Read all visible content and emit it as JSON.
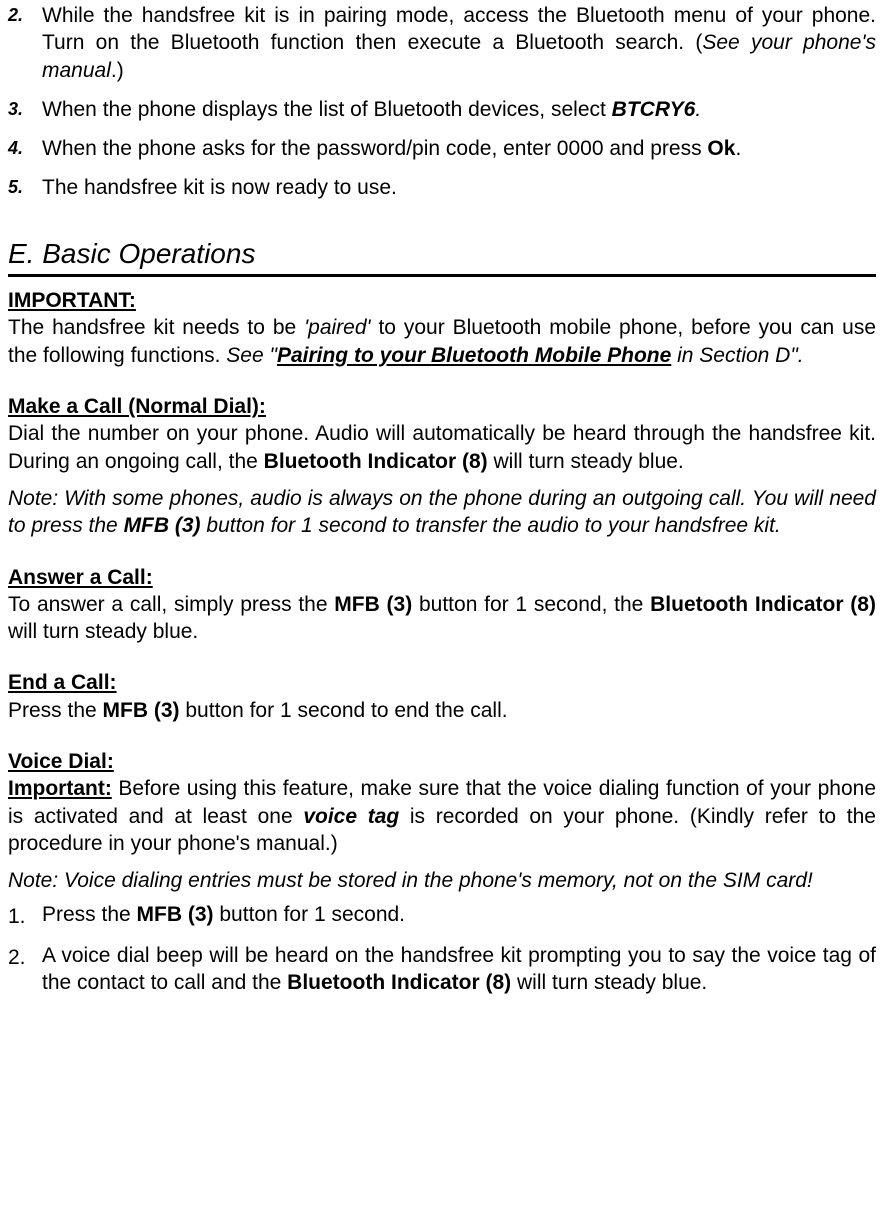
{
  "top_steps": [
    {
      "marker": "2.",
      "pre": "While the handsfree kit is in pairing mode, access the Bluetooth menu of your phone. Turn on the Bluetooth function then execute a Bluetooth search. (",
      "note": "See your phone's manual",
      "post": ".)"
    },
    {
      "marker": "3.",
      "pre": "When the phone displays the list of Bluetooth devices, select ",
      "em": "BTCRY6",
      "post": "."
    },
    {
      "marker": "4.",
      "pre": "When the phone asks for the password/pin code, enter 0000 and press ",
      "em": "Ok",
      "post": "."
    },
    {
      "marker": "5.",
      "pre": "The handsfree kit is now ready to use."
    }
  ],
  "section_e": "E. Basic Operations",
  "important": {
    "label": "IMPORTANT:",
    "pre": "The handsfree kit needs to be ",
    "paired": "'paired'",
    "mid": " to your Bluetooth mobile phone, before you can use the following functions.  ",
    "see_open": "See \"",
    "see_link": "Pairing to your Bluetooth Mobile Phone",
    "see_close": " in Section D\"."
  },
  "make_call": {
    "label": "Make a Call (Normal Dial):",
    "pre": "Dial the number on your phone.  Audio will automatically be heard through the handsfree kit.  During an ongoing call, the ",
    "bold": "Bluetooth Indicator (8)",
    "post": " will turn steady blue.",
    "note_pre": "Note: With some phones, audio is always on the phone during an outgoing call.  You will need to press the ",
    "note_em": "MFB (3)",
    "note_post": " button for 1 second to transfer the audio to your handsfree kit."
  },
  "answer": {
    "label": "Answer a Call:",
    "pre": "To answer a call, simply press the ",
    "b1": "MFB (3)",
    "mid": " button for 1 second, the ",
    "b2": "Bluetooth Indicator (8)",
    "post": " will turn steady blue."
  },
  "end": {
    "label": "End a Call:",
    "pre": "Press the ",
    "b1": "MFB (3)",
    "post": " button for 1 second to end the call."
  },
  "voice": {
    "label": "Voice Dial:",
    "imp_label": "Important:",
    "imp_pre": " Before using this feature, make sure that the voice dialing function of your phone is activated and at least one ",
    "imp_em": "voice tag",
    "imp_post": " is recorded on your phone. (Kindly refer to the procedure in your phone's manual.)",
    "note": "Note: Voice dialing entries must be stored in the phone's memory, not on the SIM card!",
    "steps": [
      {
        "marker": "1.",
        "pre": "Press the ",
        "b1": "MFB (3)",
        "post": " button for 1 second."
      },
      {
        "marker": "2.",
        "pre": "A voice dial beep will be heard on the handsfree kit prompting you to say the voice tag of the contact to call and the ",
        "b1": "Bluetooth Indicator (8)",
        "post": " will turn steady blue."
      }
    ]
  }
}
